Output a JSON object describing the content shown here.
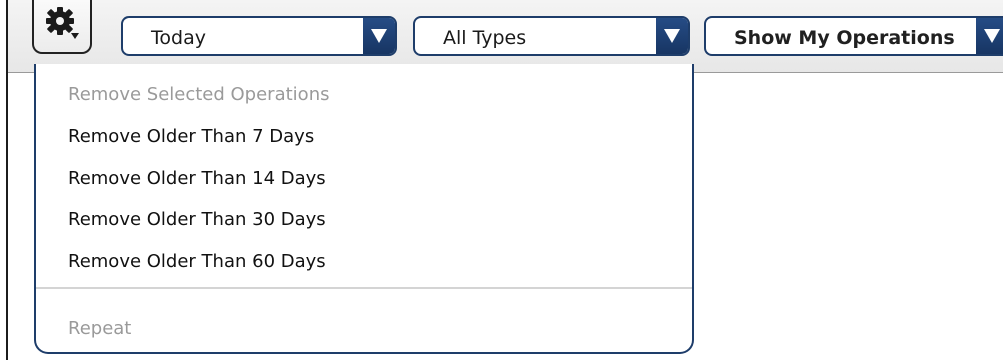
{
  "toolbar": {
    "gear_icon": "gear-with-dropdown-icon",
    "date_filter": {
      "selected": "Today",
      "arrow_icon": "triangle-down-icon"
    },
    "type_filter": {
      "selected": "All Types",
      "arrow_icon": "triangle-down-icon"
    },
    "scope_filter": {
      "selected": "Show My Operations",
      "arrow_icon": "triangle-down-icon"
    }
  },
  "menu": {
    "items": [
      {
        "label": "Remove Selected Operations",
        "enabled": false
      },
      {
        "label": "Remove Older Than 7 Days",
        "enabled": true
      },
      {
        "label": "Remove Older Than 14 Days",
        "enabled": true
      },
      {
        "label": "Remove Older Than 30 Days",
        "enabled": true
      },
      {
        "label": "Remove Older Than 60 Days",
        "enabled": true
      }
    ],
    "footer_item": {
      "label": "Repeat",
      "enabled": false
    }
  },
  "colors": {
    "accent_border": "#1e3d6a",
    "arrow_fill": "#173563",
    "disabled_text": "#9a9a9a",
    "separator": "#d4d4d4"
  }
}
